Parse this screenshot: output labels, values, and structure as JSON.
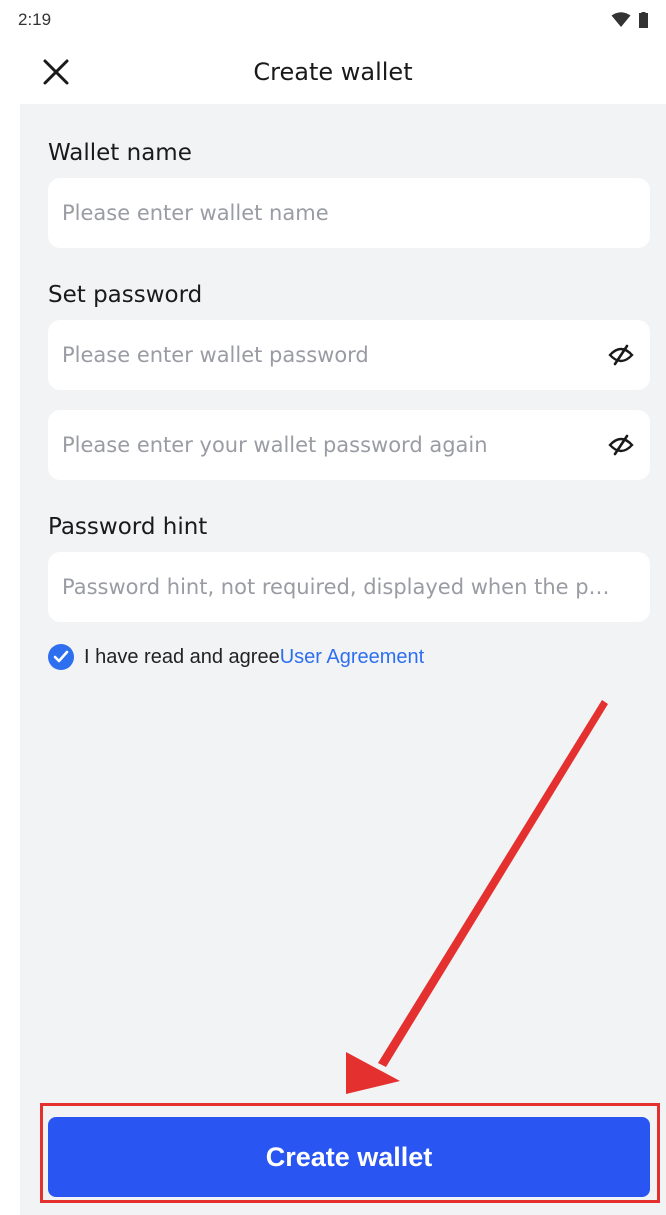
{
  "status_bar": {
    "time": "2:19",
    "icons": [
      "wifi-icon",
      "battery-icon"
    ]
  },
  "header": {
    "title": "Create wallet",
    "close_icon": "close-icon"
  },
  "form": {
    "wallet_name": {
      "label": "Wallet name",
      "placeholder": "Please enter wallet name",
      "value": ""
    },
    "password": {
      "label": "Set password",
      "placeholder": "Please enter wallet password",
      "value": "",
      "toggle_icon": "eye-off-icon"
    },
    "password_confirm": {
      "placeholder": "Please enter your wallet password again",
      "value": "",
      "toggle_icon": "eye-off-icon"
    },
    "hint": {
      "label": "Password hint",
      "placeholder": "Password hint, not required, displayed when the p…",
      "value": ""
    },
    "agreement": {
      "checked": true,
      "text": "I have read and agree",
      "link_text": "User Agreement"
    }
  },
  "primary_action": {
    "label": "Create wallet"
  },
  "colors": {
    "accent": "#2956f2",
    "link": "#2e6ff0",
    "annotation": "#e53030",
    "background": "#f2f3f5"
  }
}
